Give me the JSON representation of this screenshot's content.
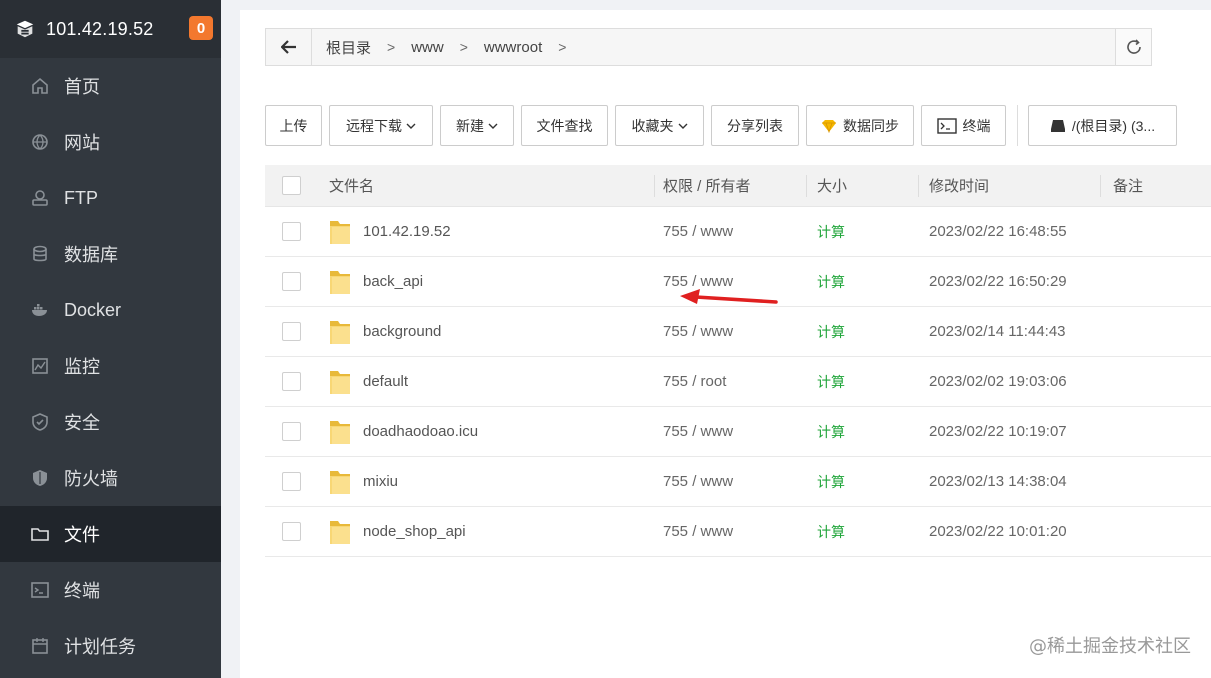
{
  "sidebar": {
    "server_ip": "101.42.19.52",
    "badge_count": "0",
    "items": [
      {
        "label": "首页",
        "icon": "home-icon"
      },
      {
        "label": "网站",
        "icon": "globe-icon"
      },
      {
        "label": "FTP",
        "icon": "ftp-icon"
      },
      {
        "label": "数据库",
        "icon": "database-icon"
      },
      {
        "label": "Docker",
        "icon": "docker-icon"
      },
      {
        "label": "监控",
        "icon": "monitor-icon"
      },
      {
        "label": "安全",
        "icon": "shield-check-icon"
      },
      {
        "label": "防火墙",
        "icon": "firewall-icon"
      },
      {
        "label": "文件",
        "icon": "folder-icon",
        "active": true
      },
      {
        "label": "终端",
        "icon": "terminal-icon"
      },
      {
        "label": "计划任务",
        "icon": "calendar-icon"
      }
    ]
  },
  "pathbar": {
    "crumbs": [
      "根目录",
      "www",
      "wwwroot"
    ]
  },
  "toolbar": {
    "upload": "上传",
    "remote_download": "远程下载",
    "new": "新建",
    "file_search": "文件查找",
    "favorites": "收藏夹",
    "share_list": "分享列表",
    "data_sync": "数据同步",
    "terminal": "终端",
    "disk": "/(根目录) (3..."
  },
  "table": {
    "headers": {
      "name": "文件名",
      "perm": "权限 / 所有者",
      "size": "大小",
      "mtime": "修改时间",
      "note": "备注"
    },
    "rows": [
      {
        "name": "101.42.19.52",
        "perm": "755 / www",
        "size": "计算",
        "mtime": "2023/02/22 16:48:55"
      },
      {
        "name": "back_api",
        "perm": "755 / www",
        "size": "计算",
        "mtime": "2023/02/22 16:50:29"
      },
      {
        "name": "background",
        "perm": "755 / www",
        "size": "计算",
        "mtime": "2023/02/14 11:44:43"
      },
      {
        "name": "default",
        "perm": "755 / root",
        "size": "计算",
        "mtime": "2023/02/02 19:03:06"
      },
      {
        "name": "doadhaodoao.icu",
        "perm": "755 / www",
        "size": "计算",
        "mtime": "2023/02/22 10:19:07"
      },
      {
        "name": "mixiu",
        "perm": "755 / www",
        "size": "计算",
        "mtime": "2023/02/13 14:38:04"
      },
      {
        "name": "node_shop_api",
        "perm": "755 / www",
        "size": "计算",
        "mtime": "2023/02/22 10:01:20"
      }
    ]
  },
  "watermark": "@稀土掘金技术社区",
  "colors": {
    "sidebar_bg": "#32383f",
    "accent_green": "#20a53a",
    "badge_orange": "#f3782e",
    "arrow_red": "#e02020"
  }
}
